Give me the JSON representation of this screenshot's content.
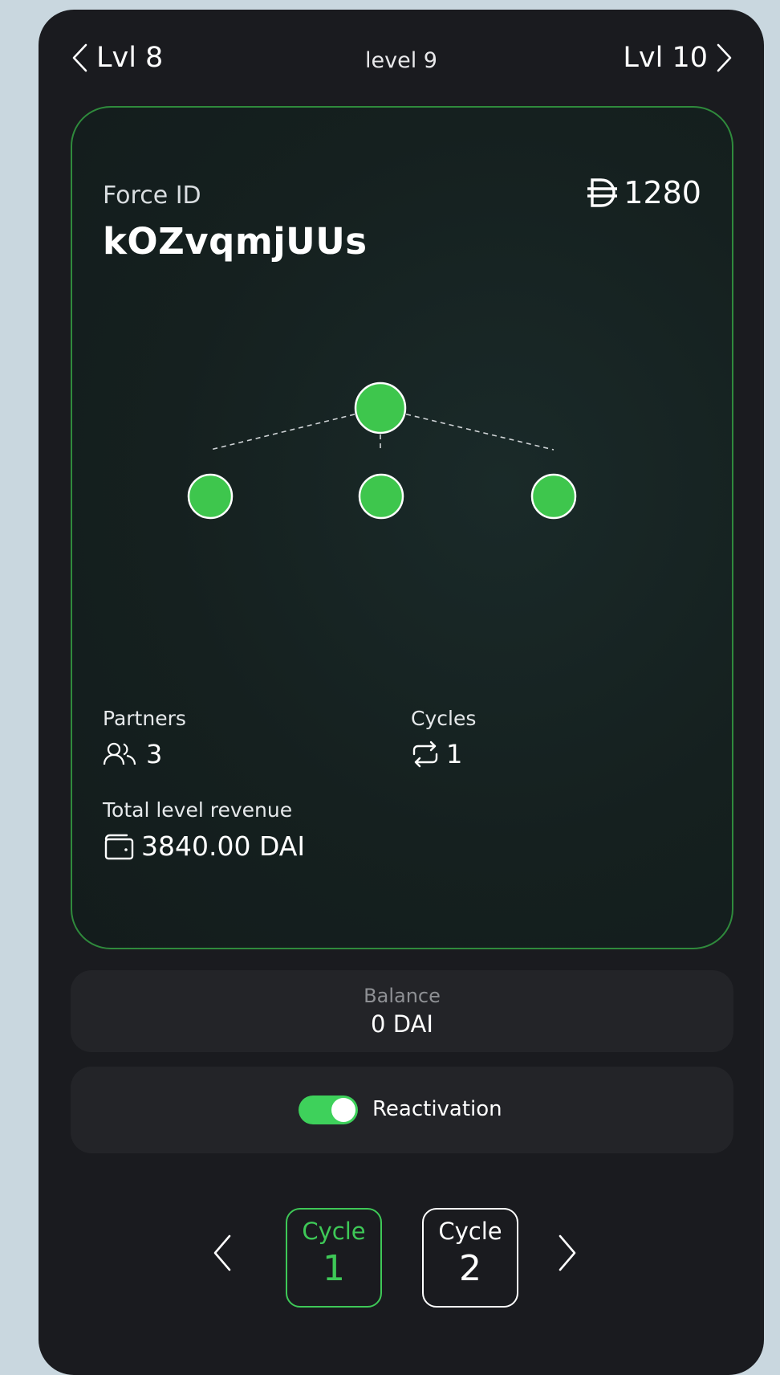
{
  "header": {
    "prev_label": "Lvl 8",
    "title": "level 9",
    "next_label": "Lvl 10"
  },
  "card": {
    "force_id_label": "Force ID",
    "force_id": "kOZvqmjUUs",
    "amount": "1280",
    "amount_icon": "dai-icon",
    "partners_label": "Partners",
    "partners_value": "3",
    "cycles_label": "Cycles",
    "cycles_value": "1",
    "revenue_label": "Total level revenue",
    "revenue_value": "3840.00 DAI"
  },
  "balance": {
    "label": "Balance",
    "value": "0 DAI"
  },
  "reactivation": {
    "label": "Reactivation",
    "enabled": true
  },
  "cycles": [
    {
      "label": "Cycle",
      "number": "1",
      "active": true
    },
    {
      "label": "Cycle",
      "number": "2",
      "active": false
    }
  ],
  "colors": {
    "accent_green": "#3ed15b",
    "panel_bg": "#1a1b1f",
    "box_bg": "#232428",
    "card_border": "#2f8a3c",
    "page_bg": "#c9d7df"
  }
}
